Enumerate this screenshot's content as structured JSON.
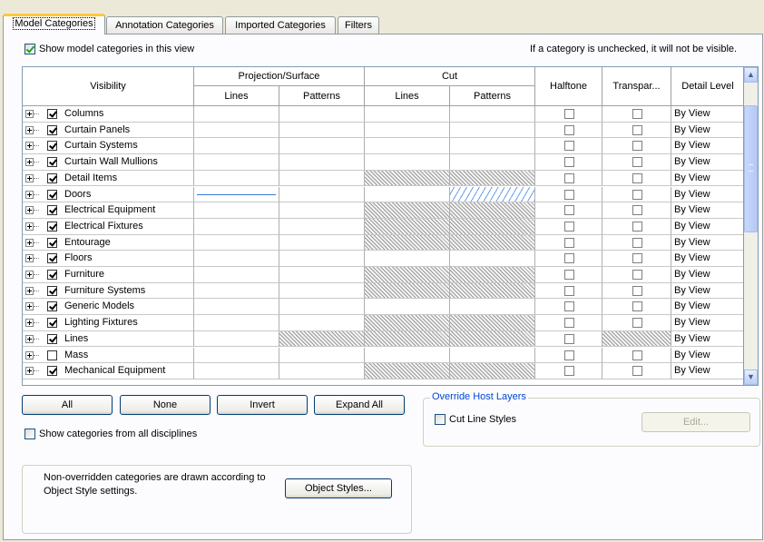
{
  "tabs": [
    {
      "label": "Model Categories",
      "active": true
    },
    {
      "label": "Annotation Categories",
      "active": false
    },
    {
      "label": "Imported Categories",
      "active": false
    },
    {
      "label": "Filters",
      "active": false
    }
  ],
  "show_model": {
    "label": "Show model categories in this view",
    "checked": true
  },
  "hint_text": "If a category is unchecked, it will not be visible.",
  "headers": {
    "visibility": "Visibility",
    "projection_surface": "Projection/Surface",
    "cut": "Cut",
    "lines": "Lines",
    "patterns": "Patterns",
    "halftone": "Halftone",
    "transparent": "Transpar...",
    "detail_level": "Detail Level"
  },
  "rows": [
    {
      "name": "Columns",
      "checked": true,
      "cut_hatched": false,
      "proj_pattern_hatched": false,
      "transp_hatched": false,
      "detail": "By View"
    },
    {
      "name": "Curtain Panels",
      "checked": true,
      "cut_hatched": false,
      "proj_pattern_hatched": false,
      "transp_hatched": false,
      "detail": "By View"
    },
    {
      "name": "Curtain Systems",
      "checked": true,
      "cut_hatched": false,
      "proj_pattern_hatched": false,
      "transp_hatched": false,
      "detail": "By View"
    },
    {
      "name": "Curtain Wall Mullions",
      "checked": true,
      "cut_hatched": false,
      "proj_pattern_hatched": false,
      "transp_hatched": false,
      "detail": "By View"
    },
    {
      "name": "Detail Items",
      "checked": true,
      "cut_hatched": true,
      "proj_pattern_hatched": false,
      "transp_hatched": false,
      "detail": "By View"
    },
    {
      "name": "Doors",
      "checked": true,
      "cut_hatched": false,
      "proj_pattern_hatched": false,
      "transp_hatched": false,
      "detail": "By View",
      "proj_line_override": true,
      "cut_pattern_override": true
    },
    {
      "name": "Electrical Equipment",
      "checked": true,
      "cut_hatched": true,
      "proj_pattern_hatched": false,
      "transp_hatched": false,
      "detail": "By View"
    },
    {
      "name": "Electrical Fixtures",
      "checked": true,
      "cut_hatched": true,
      "proj_pattern_hatched": false,
      "transp_hatched": false,
      "detail": "By View"
    },
    {
      "name": "Entourage",
      "checked": true,
      "cut_hatched": true,
      "proj_pattern_hatched": false,
      "transp_hatched": false,
      "detail": "By View"
    },
    {
      "name": "Floors",
      "checked": true,
      "cut_hatched": false,
      "proj_pattern_hatched": false,
      "transp_hatched": false,
      "detail": "By View"
    },
    {
      "name": "Furniture",
      "checked": true,
      "cut_hatched": true,
      "proj_pattern_hatched": false,
      "transp_hatched": false,
      "detail": "By View"
    },
    {
      "name": "Furniture Systems",
      "checked": true,
      "cut_hatched": true,
      "proj_pattern_hatched": false,
      "transp_hatched": false,
      "detail": "By View"
    },
    {
      "name": "Generic Models",
      "checked": true,
      "cut_hatched": false,
      "proj_pattern_hatched": false,
      "transp_hatched": false,
      "detail": "By View"
    },
    {
      "name": "Lighting Fixtures",
      "checked": true,
      "cut_hatched": true,
      "proj_pattern_hatched": false,
      "transp_hatched": false,
      "detail": "By View"
    },
    {
      "name": "Lines",
      "checked": true,
      "cut_hatched": true,
      "proj_pattern_hatched": true,
      "transp_hatched": true,
      "detail": "By View"
    },
    {
      "name": "Mass",
      "checked": false,
      "cut_hatched": false,
      "proj_pattern_hatched": false,
      "transp_hatched": false,
      "detail": "By View"
    },
    {
      "name": "Mechanical Equipment",
      "checked": true,
      "cut_hatched": true,
      "proj_pattern_hatched": false,
      "transp_hatched": false,
      "detail": "By View"
    }
  ],
  "buttons": {
    "all": "All",
    "none": "None",
    "invert": "Invert",
    "expand_all": "Expand All",
    "object_styles": "Object Styles...",
    "edit": "Edit..."
  },
  "show_all_disciplines": {
    "label": "Show categories from all disciplines",
    "checked": false
  },
  "override_host": {
    "title": "Override Host Layers",
    "cut_line_label": "Cut Line Styles",
    "checked": false
  },
  "note_text": "Non-overridden categories are drawn according to Object Style settings.",
  "colors": {
    "accent": "#ffc83c",
    "check_green": "#21a121",
    "override_blue": "#3a7bd5",
    "panel_bg": "#fcfcfe"
  }
}
